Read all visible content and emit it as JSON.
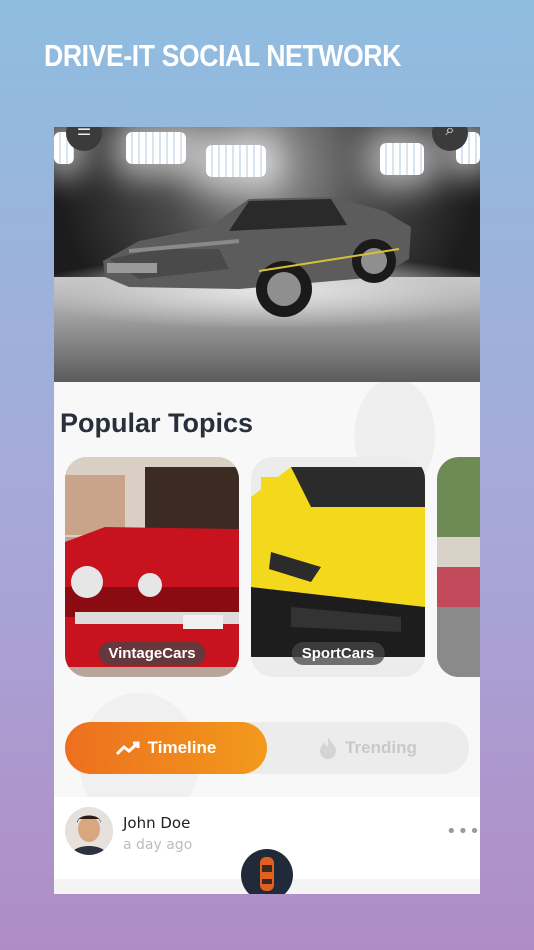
{
  "promo": {
    "title": "DRIVE-IT SOCIAL NETWORK"
  },
  "hero": {
    "menu_icon": "menu-icon",
    "search_icon": "search-icon"
  },
  "popular": {
    "title": "Popular Topics",
    "topics": [
      {
        "label": "VintageCars",
        "color": "#c8131e"
      },
      {
        "label": "SportCars",
        "color": "#f4d81b"
      },
      {
        "label": "",
        "color": "#c24a5a"
      }
    ]
  },
  "tabs": {
    "active": {
      "label": "Timeline",
      "icon": "trending-up-icon"
    },
    "inactive": {
      "label": "Trending",
      "icon": "flame-icon"
    }
  },
  "post": {
    "author": "John Doe",
    "time": "a day ago",
    "more": "•••"
  },
  "colors": {
    "accent_start": "#ed6f1f",
    "accent_end": "#f29a1b",
    "title": "#27303c",
    "fab": "#202a38"
  }
}
